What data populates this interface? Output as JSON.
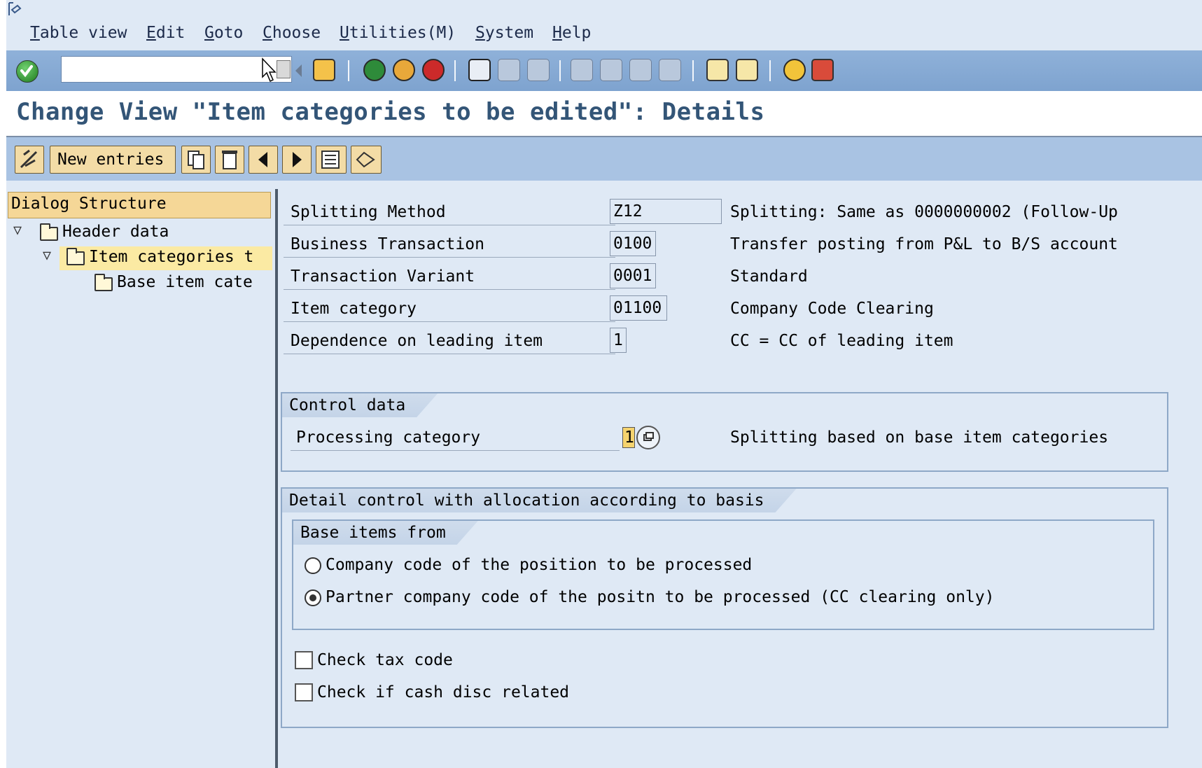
{
  "menu": {
    "items": [
      "Table view",
      "Edit",
      "Goto",
      "Choose",
      "Utilities(M)",
      "System",
      "Help"
    ]
  },
  "command_field": {
    "value": ""
  },
  "title": "Change View \"Item categories to be edited\": Details",
  "app_toolbar": {
    "new_entries_label": "New entries"
  },
  "tree": {
    "header": "Dialog Structure",
    "nodes": [
      {
        "label": "Header data",
        "expanded": true
      },
      {
        "label": "Item categories t",
        "expanded": true,
        "selected": true
      },
      {
        "label": "Base item cate",
        "expanded": false
      }
    ]
  },
  "fields": [
    {
      "label": "Splitting Method",
      "value": "Z12",
      "description": "Splitting: Same as 0000000002 (Follow-Up"
    },
    {
      "label": "Business Transaction",
      "value": "0100",
      "description": "Transfer posting from P&L to B/S account"
    },
    {
      "label": "Transaction Variant",
      "value": "0001",
      "description": "Standard"
    },
    {
      "label": "Item category",
      "value": "01100",
      "description": "Company Code Clearing"
    },
    {
      "label": "Dependence on leading item",
      "value": "1",
      "description": "CC = CC of leading item"
    }
  ],
  "control_data": {
    "title": "Control data",
    "processing_label": "Processing category",
    "processing_value": "1",
    "processing_description": "Splitting based on base item categories"
  },
  "detail_control": {
    "title": "Detail control with allocation according to basis",
    "base_items_title": "Base items from",
    "radio_options": [
      {
        "label": "Company code of the position to be processed",
        "selected": false
      },
      {
        "label": "Partner company code of the positn to be processed (CC clearing only)",
        "selected": true
      }
    ],
    "checkboxes": [
      {
        "label": "Check tax code",
        "checked": false
      },
      {
        "label": "Check if cash disc related",
        "checked": false
      }
    ]
  },
  "colors": {
    "window_bg": "#dfe9f5",
    "toolbar_blue": "#8fb1d9",
    "title_text": "#335577",
    "button_tan": "#f3dca6"
  }
}
